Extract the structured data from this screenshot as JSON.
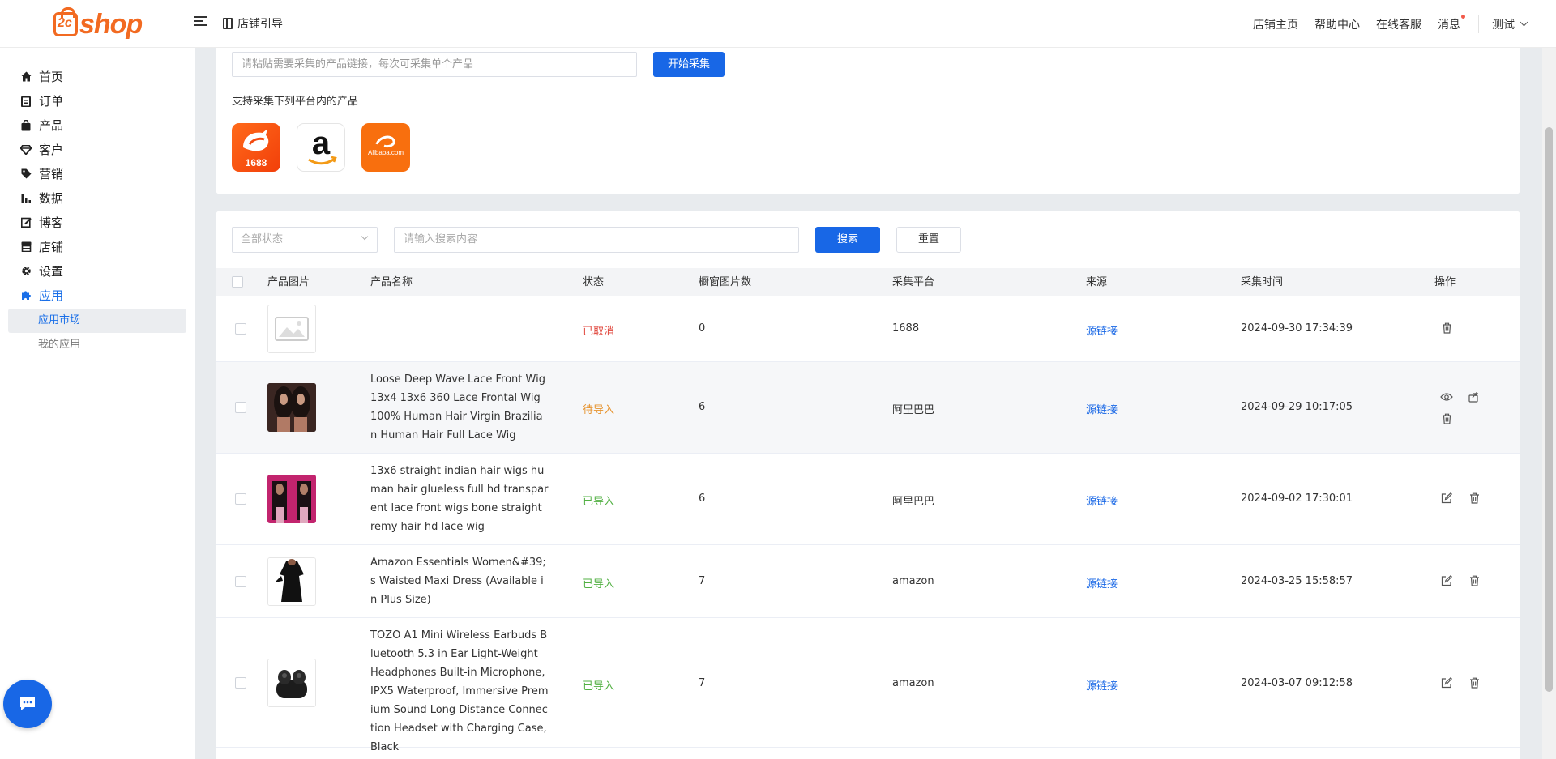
{
  "header": {
    "logo_text": "shop",
    "logo_mark": "2c",
    "guide_label": "店铺引导",
    "nav": [
      "店铺主页",
      "帮助中心",
      "在线客服",
      "消息"
    ],
    "user_label": "测试"
  },
  "sidebar": {
    "items": [
      {
        "label": "首页",
        "icon": "home-icon"
      },
      {
        "label": "订单",
        "icon": "clipboard-icon"
      },
      {
        "label": "产品",
        "icon": "bag-icon"
      },
      {
        "label": "客户",
        "icon": "diamond-icon"
      },
      {
        "label": "营销",
        "icon": "tag-icon"
      },
      {
        "label": "数据",
        "icon": "bar-chart-icon"
      },
      {
        "label": "博客",
        "icon": "edit-icon"
      },
      {
        "label": "店铺",
        "icon": "store-icon"
      },
      {
        "label": "设置",
        "icon": "gear-icon"
      },
      {
        "label": "应用",
        "icon": "puzzle-icon"
      }
    ],
    "subitems": [
      {
        "label": "应用市场"
      },
      {
        "label": "我的应用"
      }
    ]
  },
  "collect": {
    "url_placeholder": "请粘贴需要采集的产品链接，每次可采集单个产品",
    "start_button": "开始采集",
    "support_text": "支持采集下列平台内的产品",
    "platforms": [
      {
        "name": "1688",
        "label": "1688"
      },
      {
        "name": "amazon",
        "label": "a"
      },
      {
        "name": "alibaba",
        "label": "Alibaba.com"
      }
    ]
  },
  "filter": {
    "status_placeholder": "全部状态",
    "search_placeholder": "请输入搜索内容",
    "search_button": "搜索",
    "reset_button": "重置"
  },
  "table": {
    "columns": [
      "产品图片",
      "产品名称",
      "状态",
      "橱窗图片数",
      "采集平台",
      "来源",
      "采集时间",
      "操作"
    ],
    "rows": [
      {
        "name": "",
        "status": "已取消",
        "count": "0",
        "platform": "1688",
        "source": "源链接",
        "time": "2024-09-30 17:34:39"
      },
      {
        "name": "Loose Deep Wave Lace Front Wig 13x4 13x6 360 Lace Frontal Wig 100% Human Hair Virgin Brazilian Human Hair Full Lace Wig",
        "status": "待导入",
        "count": "6",
        "platform": "阿里巴巴",
        "source": "源链接",
        "time": "2024-09-29 10:17:05"
      },
      {
        "name": "13x6 straight indian hair wigs human hair glueless full hd transparent lace front wigs bone straight remy hair hd lace wig",
        "status": "已导入",
        "count": "6",
        "platform": "阿里巴巴",
        "source": "源链接",
        "time": "2024-09-02 17:30:01"
      },
      {
        "name": "Amazon Essentials Women&#39;s Waisted Maxi Dress (Available in Plus Size)",
        "status": "已导入",
        "count": "7",
        "platform": "amazon",
        "source": "源链接",
        "time": "2024-03-25 15:58:57"
      },
      {
        "name": "TOZO A1 Mini Wireless Earbuds Bluetooth 5.3 in Ear Light-Weight Headphones Built-in Microphone, IPX5 Waterproof, Immersive Premium Sound Long Distance Connection Headset with Charging Case, Black",
        "status": "已导入",
        "count": "7",
        "platform": "amazon",
        "source": "源链接",
        "time": "2024-03-07 09:12:58"
      }
    ]
  },
  "colors": {
    "primary": "#1867e6",
    "brand": "#f26a21",
    "cancelled": "#e0463c",
    "pending": "#e6932e",
    "imported": "#52b043"
  }
}
